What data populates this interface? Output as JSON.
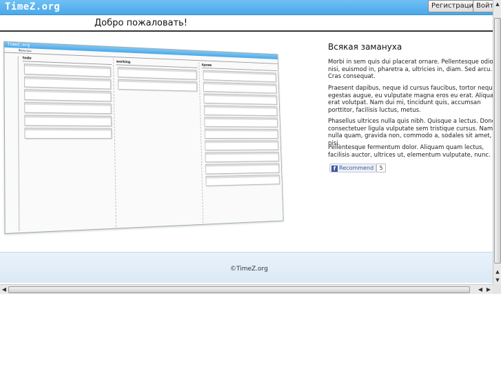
{
  "brand": {
    "logo": "TimeZ.org"
  },
  "header": {
    "register_label": "Регистрация",
    "login_label": "Войти",
    "welcome": "Добро пожаловать!"
  },
  "screenshot": {
    "app_name": "TimeZ.org",
    "filters": "Фильтры",
    "columns": [
      "todo",
      "working",
      "Архив"
    ]
  },
  "side": {
    "title": "Всякая замануха",
    "paragraphs": [
      "Morbi in sem quis dui placerat ornare. Pellentesque odio nisi, euismod in, pharetra a, ultricies in, diam. Sed arcu. Cras consequat.",
      "Praesent dapibus, neque id cursus faucibus, tortor neque egestas augue, eu vulputate magna eros eu erat. Aliquam erat volutpat. Nam dui mi, tincidunt quis, accumsan porttitor, facilisis luctus, metus.",
      "Phasellus ultrices nulla quis nibh. Quisque a lectus. Donec consectetuer ligula vulputate sem tristique cursus. Nam nulla quam, gravida non, commodo a, sodales sit amet, nisi.",
      "Pellentesque fermentum dolor. Aliquam quam lectus, facilisis auctor, ultrices ut, elementum vulputate, nunc."
    ],
    "recommend_label": "Recommend",
    "recommend_count": "5"
  },
  "footer": {
    "copyright": "©TimeZ.org"
  }
}
